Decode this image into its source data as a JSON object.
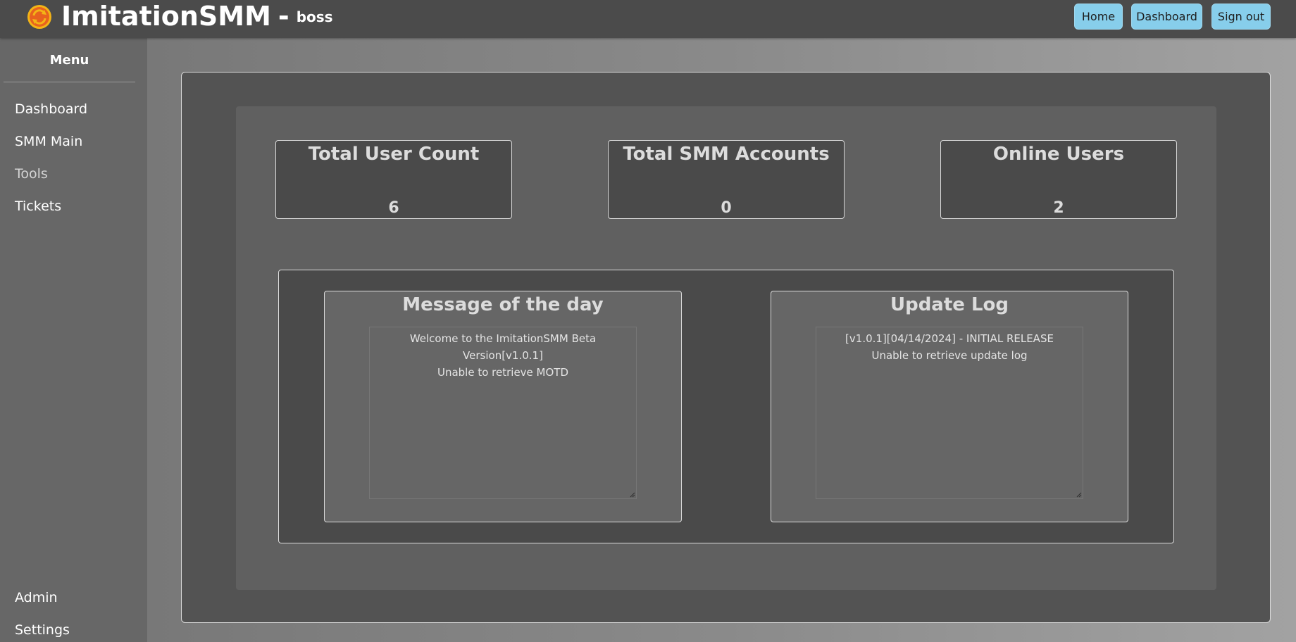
{
  "header": {
    "brand": "ImitationSMM",
    "separator": "-",
    "username": "boss",
    "buttons": {
      "home": "Home",
      "dashboard": "Dashboard",
      "signout": "Sign out"
    },
    "button_color": "#87ceeb",
    "logo_colors": [
      "#e8621e",
      "#f3b416"
    ]
  },
  "sidebar": {
    "title": "Menu",
    "items": [
      {
        "label": "Dashboard"
      },
      {
        "label": "SMM Main"
      },
      {
        "label": "Tools"
      },
      {
        "label": "Tickets"
      }
    ],
    "bottom_items": [
      {
        "label": "Admin"
      },
      {
        "label": "Settings"
      }
    ]
  },
  "stats": [
    {
      "label": "Total User Count",
      "value": "6"
    },
    {
      "label": "Total SMM Accounts",
      "value": "0"
    },
    {
      "label": "Online Users",
      "value": "2"
    }
  ],
  "motd": {
    "title": "Message of the day",
    "lines": [
      "Welcome to the ImitationSMM Beta Version[v1.0.1]",
      "Unable to retrieve MOTD"
    ]
  },
  "update_log": {
    "title": "Update Log",
    "lines": [
      "[v1.0.1][04/14/2024] - INITIAL RELEASE",
      "Unable to retrieve update log"
    ]
  }
}
